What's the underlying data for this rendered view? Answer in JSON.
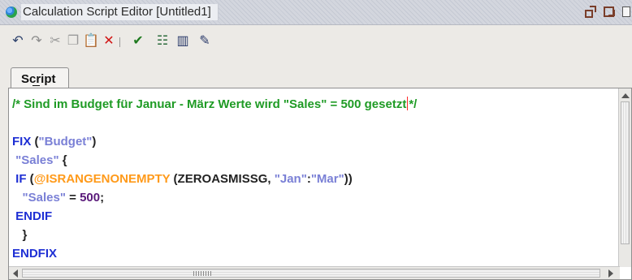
{
  "window": {
    "title": "Calculation Script Editor [Untitled1]",
    "icons": [
      "script-editor-icon",
      "restore-icon",
      "maximize-icon",
      "panel-icon"
    ]
  },
  "toolbar": {
    "buttons": [
      {
        "name": "undo-icon",
        "glyph": "↶",
        "color": "#2b3f6a"
      },
      {
        "name": "redo-icon",
        "glyph": "↷",
        "color": "#8a8a8a"
      },
      {
        "name": "cut-icon",
        "glyph": "✂",
        "color": "#9a9a9a"
      },
      {
        "name": "copy-icon",
        "glyph": "❐",
        "color": "#9a9a9a"
      },
      {
        "name": "paste-icon",
        "glyph": "📋",
        "color": "#4a4a4a"
      },
      {
        "name": "delete-icon",
        "glyph": "✕",
        "color": "#d11515"
      },
      {
        "name": "validate-icon",
        "glyph": "✔",
        "color": "#1f7a1f"
      },
      {
        "name": "outline-icon",
        "glyph": "☷",
        "color": "#2a6a3a"
      },
      {
        "name": "members-icon",
        "glyph": "▥",
        "color": "#2a3a6a"
      },
      {
        "name": "edit-script-icon",
        "glyph": "✎",
        "color": "#2a3a6a"
      }
    ]
  },
  "tabs": [
    {
      "label": "Script",
      "active": true
    }
  ],
  "editor": {
    "cursor_color": "#ff2a2a",
    "syntax_colors": {
      "comment": "#1f9b25",
      "keyword": "#1e2fd4",
      "string": "#7a80d6",
      "function": "#ff9a1a",
      "number": "#5a1a7a",
      "plain": "#222222"
    },
    "lines": [
      [
        {
          "t": "/* Sind im Budget für Januar - März Werte wird \"Sales\" = 500 gesetzt",
          "c": "comment"
        },
        {
          "t": "",
          "c": "cursor"
        },
        {
          "t": "*/",
          "c": "comment"
        }
      ],
      [],
      [
        {
          "t": "FIX",
          "c": "kw"
        },
        {
          "t": " (",
          "c": "plain"
        },
        {
          "t": "\"Budget\"",
          "c": "str"
        },
        {
          "t": ")",
          "c": "plain"
        }
      ],
      [
        {
          "t": " ",
          "c": "plain"
        },
        {
          "t": "\"Sales\"",
          "c": "str"
        },
        {
          "t": " {",
          "c": "plain"
        }
      ],
      [
        {
          "t": " ",
          "c": "plain"
        },
        {
          "t": "IF",
          "c": "kw"
        },
        {
          "t": " (",
          "c": "plain"
        },
        {
          "t": "@ISRANGENONEMPTY",
          "c": "fn"
        },
        {
          "t": " (ZEROASMISSG, ",
          "c": "plain"
        },
        {
          "t": "\"Jan\"",
          "c": "str"
        },
        {
          "t": ":",
          "c": "plain"
        },
        {
          "t": "\"Mar\"",
          "c": "str"
        },
        {
          "t": "))",
          "c": "plain"
        }
      ],
      [
        {
          "t": "   ",
          "c": "plain"
        },
        {
          "t": "\"Sales\"",
          "c": "str"
        },
        {
          "t": " = ",
          "c": "plain"
        },
        {
          "t": "500",
          "c": "num"
        },
        {
          "t": ";",
          "c": "plain"
        }
      ],
      [
        {
          "t": " ",
          "c": "plain"
        },
        {
          "t": "ENDIF",
          "c": "kw"
        }
      ],
      [
        {
          "t": "   }",
          "c": "plain"
        }
      ],
      [
        {
          "t": "ENDFIX",
          "c": "kw"
        }
      ]
    ]
  }
}
